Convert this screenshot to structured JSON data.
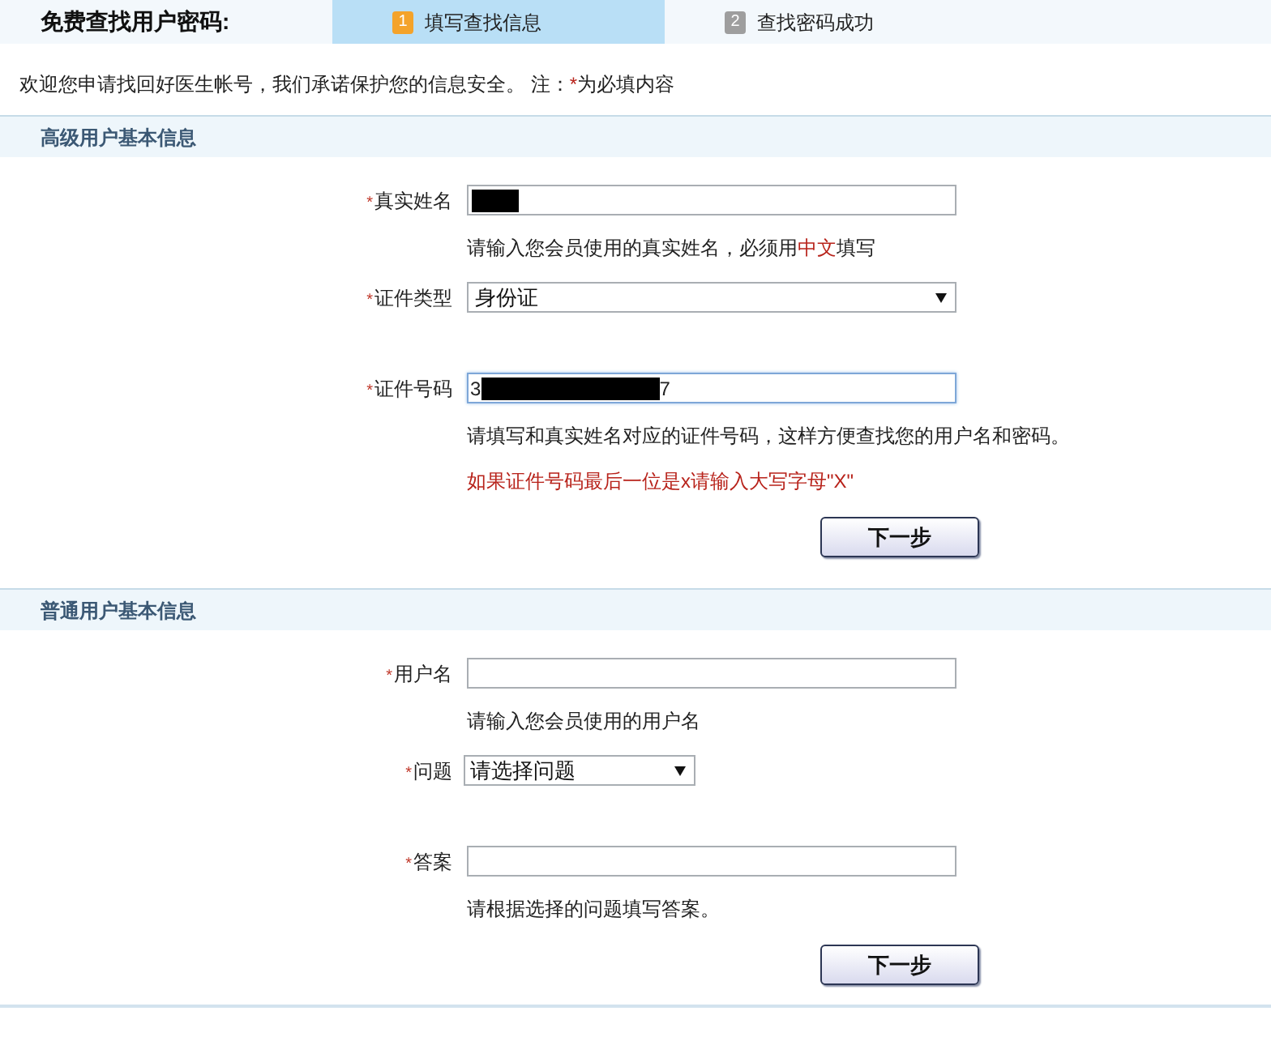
{
  "header": {
    "title": "免费查找用户密码:"
  },
  "steps": [
    {
      "number": "1",
      "label": "填写查找信息",
      "selected": true
    },
    {
      "number": "2",
      "label": "查找密码成功",
      "selected": false
    }
  ],
  "welcome": [
    {
      "text": "欢迎您申请找回好医生帐号，我们承诺保护您的信息安全。 注：",
      "highlight": false
    },
    {
      "text": "*",
      "highlight": true
    },
    {
      "text": "为必填内容",
      "highlight": false
    }
  ],
  "sections": [
    {
      "title": "高级用户基本信息",
      "fields": [
        {
          "kind": "text",
          "required_mark": "*",
          "label": "真实姓名",
          "redacted": true,
          "focused": false,
          "hint": [
            {
              "text": "请输入您会员使用的真实姓名，必须用",
              "highlight": false
            },
            {
              "text": "中文",
              "highlight": true
            },
            {
              "text": "填写",
              "highlight": false
            }
          ]
        },
        {
          "kind": "select",
          "required_mark": "*",
          "label": "证件类型",
          "value": "身份证"
        },
        {
          "kind": "text",
          "required_mark": "*",
          "label": "证件号码",
          "value_parts": [
            "3",
            "7"
          ],
          "redacted": true,
          "focused": true,
          "hint": [
            {
              "text": "请填写和真实姓名对应的证件号码，这样方便查找您的用户名和密码。",
              "highlight": false
            }
          ],
          "note": "如果证件号码最后一位是x请输入大写字母\"X\""
        }
      ],
      "button": "下一步"
    },
    {
      "title": "普通用户基本信息",
      "fields": [
        {
          "kind": "text",
          "required_mark": "*",
          "label": "用户名",
          "redacted": false,
          "focused": false,
          "hint": [
            {
              "text": "请输入您会员使用的用户名",
              "highlight": false
            }
          ]
        },
        {
          "kind": "select",
          "required_mark": "*",
          "label": "问题",
          "placeholder": "请选择问题"
        },
        {
          "kind": "text",
          "required_mark": "*",
          "label": "答案",
          "redacted": false,
          "focused": false,
          "hint": [
            {
              "text": "请根据选择的问题填写答案。",
              "highlight": false
            }
          ]
        }
      ],
      "button": "下一步"
    }
  ]
}
